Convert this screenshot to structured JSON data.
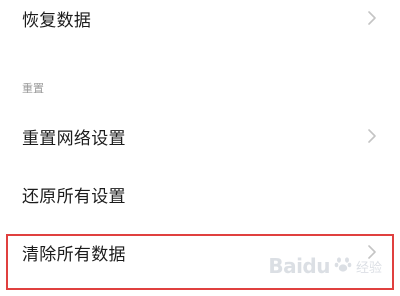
{
  "settings": {
    "rows": [
      {
        "label": "恢复数据",
        "has_chevron": true
      },
      {
        "label": "重置网络设置",
        "has_chevron": true
      },
      {
        "label": "还原所有设置",
        "has_chevron": false
      },
      {
        "label": "清除所有数据",
        "has_chevron": true
      }
    ],
    "section_header": "重置"
  },
  "watermark": {
    "brand": "Baidu",
    "text": "经验"
  },
  "icons": {
    "chevron": "chevron-right-icon",
    "watermark_paw": "paw-icon"
  },
  "colors": {
    "highlight_border": "#e0403f",
    "chevron": "#c4c4c4",
    "section_header": "#9a9a9a",
    "text": "#1c1c1c"
  }
}
